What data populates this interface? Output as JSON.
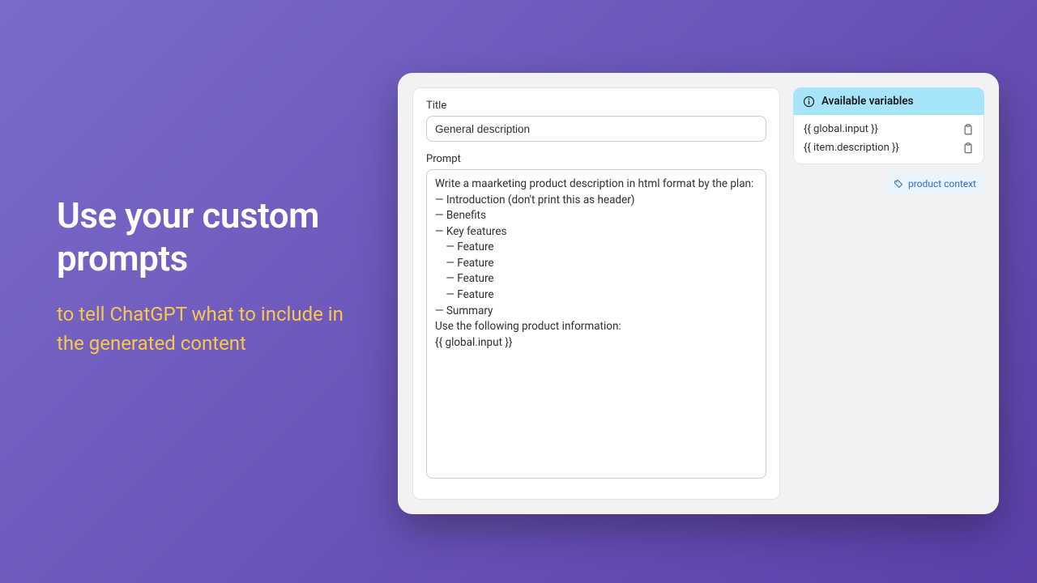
{
  "hero": {
    "title": "Use your custom prompts",
    "subtitle": "to tell ChatGPT what to include in the generated content"
  },
  "form": {
    "title_label": "Title",
    "title_value": "General description",
    "prompt_label": "Prompt",
    "prompt_value": "Write a maarketing product description in html format by the plan:\n— Introduction (don't print this as header)\n— Benefits\n— Key features\n    — Feature\n    — Feature\n    — Feature\n    — Feature\n— Summary\nUse the following product information:\n{{ global.input }}"
  },
  "variables": {
    "header": "Available variables",
    "items": [
      "{{ global.input }}",
      "{{ item.description }}"
    ]
  },
  "context_tag": "product context"
}
